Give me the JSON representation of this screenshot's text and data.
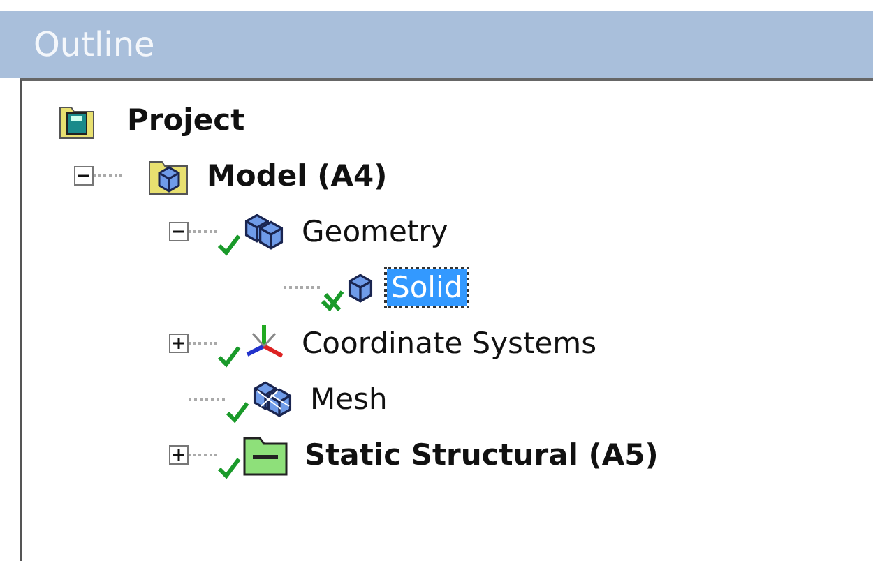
{
  "panel": {
    "title": "Outline"
  },
  "tree": [
    {
      "label": "Project",
      "kind": "project",
      "bold": true,
      "children": [
        {
          "label": "Model (A4)",
          "kind": "model",
          "bold": true,
          "expanded": true,
          "children": [
            {
              "label": "Geometry",
              "kind": "geometry",
              "bold": false,
              "expanded": true,
              "done": true,
              "suppressed": false,
              "children": [
                {
                  "label": "Solid",
                  "kind": "body",
                  "bold": false,
                  "selected": true,
                  "done": true,
                  "suppressed": true
                }
              ]
            },
            {
              "label": "Coordinate Systems",
              "kind": "coordinates",
              "bold": false,
              "expanded": false,
              "done": true,
              "suppressed": false,
              "selected": false
            },
            {
              "label": "Mesh",
              "kind": "mesh",
              "bold": false,
              "done": true,
              "suppressed": false,
              "selected": false
            },
            {
              "label": "Static Structural (A5)",
              "kind": "analysis",
              "bold": true,
              "expanded": false,
              "done": true,
              "suppressed": false,
              "selected": false
            }
          ]
        }
      ]
    }
  ]
}
